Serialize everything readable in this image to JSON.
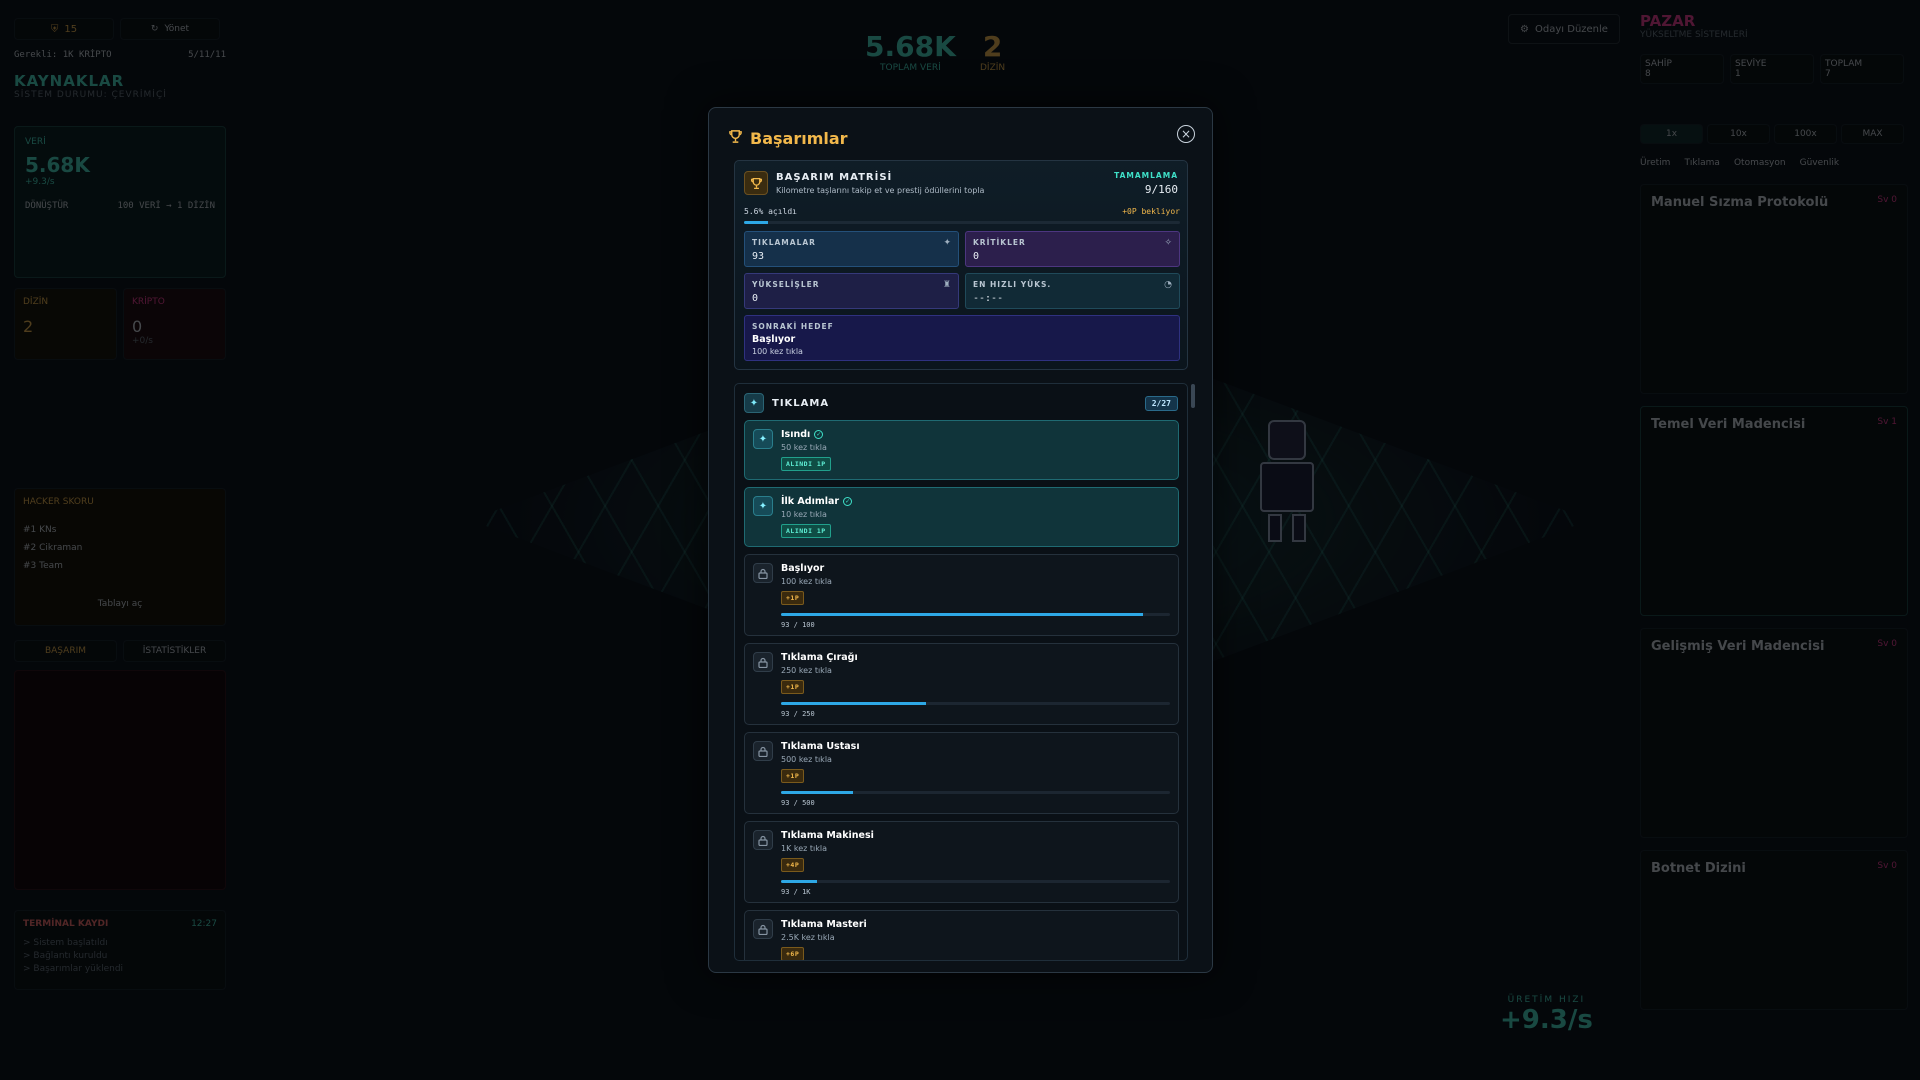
{
  "background": {
    "left_panel": {
      "shield_count": "15",
      "tab_other": "Yönet",
      "required_line": "Gerekli: 1K KRİPTO",
      "required_value": "5/11/11",
      "section_title": "KAYNAKLAR",
      "section_subtitle": "SİSTEM DURUMU: ÇEVRİMİÇİ",
      "data_label": "VERİ",
      "data_value": "5.68K",
      "data_rate": "+9.3/s",
      "convert_label": "DÖNÜŞTÜR",
      "convert_rate": "100 VERİ → 1 DİZİN",
      "dizin_label": "DİZİN",
      "dizin_value": "2",
      "kripto_label": "KRİPTO",
      "kripto_value": "0",
      "kripto_rate": "+0/s",
      "leaderboard_title": "HACKER SKORU",
      "leaderboard_rows": [
        "#1 KNs",
        "#2 Cikraman",
        "#3 Team"
      ],
      "leaderboard_link": "Tablayı aç",
      "tab_achievements": "BAŞARIM",
      "tab_stats": "İSTATİSTİKLER",
      "terminal_title": "TERMİNAL KAYDI",
      "terminal_time": "12:27",
      "terminal_lines": [
        "> Sistem başlatıldı",
        "> Bağlantı kuruldu",
        "> Başarımlar yüklendi"
      ]
    },
    "center": {
      "big_value": "5.68K",
      "big_value_label": "TOPLAM VERİ",
      "secondary_value": "2",
      "secondary_label": "DİZİN",
      "rate_label": "ÜRETİM HIZI",
      "rate_value": "+9.3/s"
    },
    "right_panel": {
      "edit_room_button": "Odayı Düzenle",
      "title": "PAZAR",
      "subtitle": "YÜKSELTME SİSTEMLERİ",
      "stats": [
        {
          "label": "SAHİP",
          "value": "8"
        },
        {
          "label": "SEVİYE",
          "value": "1"
        },
        {
          "label": "TOPLAM",
          "value": "7"
        }
      ],
      "qty_tabs": [
        "1x",
        "10x",
        "100x",
        "MAX"
      ],
      "item_tabs": [
        "Üretim",
        "Tıklama",
        "Otomasyon",
        "Güvenlik"
      ],
      "shop_items": [
        {
          "name": "Manuel Sızma Protokolü",
          "level": "Sv 0"
        },
        {
          "name": "Temel Veri Madencisi",
          "level": "Sv 1"
        },
        {
          "name": "Gelişmiş Veri Madencisi",
          "level": "Sv 0"
        },
        {
          "name": "Botnet Dizini",
          "level": "Sv 0"
        }
      ]
    }
  },
  "modal": {
    "title": "Başarımlar",
    "matrix": {
      "title": "BAŞARIM MATRİSİ",
      "subtitle": "Kilometre taşlarını takip et ve prestij ödüllerini topla",
      "completion_label": "TAMAMLAMA",
      "completion_value": "9/160",
      "progress_left": "5.6% açıldı",
      "progress_right": "+0P bekliyor",
      "progress_fraction": 0.056,
      "stats": {
        "clicks_label": "TIKLAMALAR",
        "clicks_value": "93",
        "crits_label": "KRİTİKLER",
        "crits_value": "0",
        "upgrades_label": "YÜKSELİŞLER",
        "upgrades_value": "0",
        "fastest_label": "EN HIZLI YÜKS.",
        "fastest_value": "--:--"
      },
      "next_goal": {
        "label": "SONRAKİ HEDEF",
        "name": "Başlıyor",
        "desc": "100 kez tıkla"
      }
    },
    "category": {
      "title": "TIKLAMA",
      "count": "2/27",
      "achievements": [
        {
          "name": "Isındı",
          "desc": "50 kez tıkla",
          "tag": "ALINDI 1P",
          "done": true
        },
        {
          "name": "İlk Adımlar",
          "desc": "10 kez tıkla",
          "tag": "ALINDI 1P",
          "done": true
        },
        {
          "name": "Başlıyor",
          "desc": "100 kez tıkla",
          "tag": "+1P",
          "done": false,
          "progress": "93 / 100",
          "fraction": 0.93
        },
        {
          "name": "Tıklama Çırağı",
          "desc": "250 kez tıkla",
          "tag": "+1P",
          "done": false,
          "progress": "93 / 250",
          "fraction": 0.372
        },
        {
          "name": "Tıklama Ustası",
          "desc": "500 kez tıkla",
          "tag": "+1P",
          "done": false,
          "progress": "93 / 500",
          "fraction": 0.186
        },
        {
          "name": "Tıklama Makinesi",
          "desc": "1K kez tıkla",
          "tag": "+4P",
          "done": false,
          "progress": "93 / 1K",
          "fraction": 0.093
        },
        {
          "name": "Tıklama Masteri",
          "desc": "2.5K kez tıkla",
          "tag": "+6P",
          "done": false
        }
      ]
    }
  }
}
